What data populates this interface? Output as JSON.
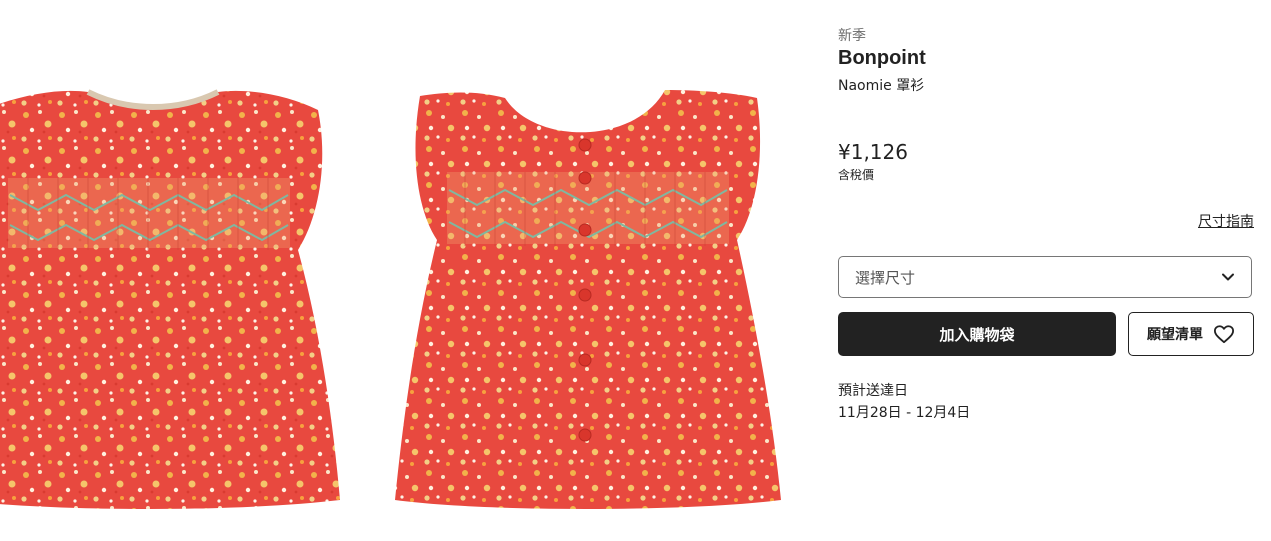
{
  "product": {
    "season_badge": "新季",
    "brand": "Bonpoint",
    "name": "Naomie 罩衫",
    "price": "¥1,126",
    "tax_note": "含稅價"
  },
  "size": {
    "guide_link": "尺寸指南",
    "select_placeholder": "選擇尺寸"
  },
  "actions": {
    "add_to_bag": "加入購物袋",
    "wishlist": "願望清單"
  },
  "delivery": {
    "label": "預計送達日",
    "dates": "11月28日 - 12月4日"
  },
  "colors": {
    "fabric_base": "#e8493f",
    "button_primary": "#222222",
    "text_muted": "#6b6b6b"
  },
  "icons": {
    "select_arrow": "chevron-down-icon",
    "wishlist": "heart-icon"
  },
  "gallery": {
    "images": [
      "product-image-front",
      "product-image-back"
    ]
  }
}
